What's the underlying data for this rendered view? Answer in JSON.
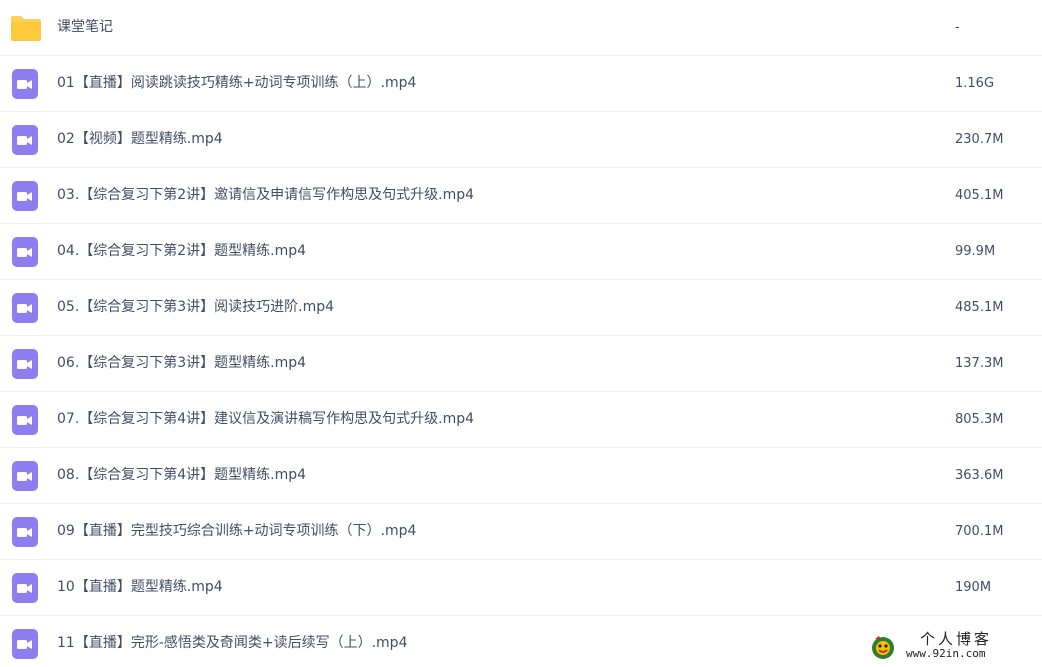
{
  "files": [
    {
      "name": "课堂笔记",
      "size": "-",
      "icon": "folder-icon",
      "color": "#ffd15c"
    },
    {
      "name": "01【直播】阅读跳读技巧精练+动词专项训练（上）.mp4",
      "size": "1.16G",
      "icon": "video-file-icon",
      "color": "#8c7df0"
    },
    {
      "name": "02【视频】题型精练.mp4",
      "size": "230.7M",
      "icon": "video-file-icon",
      "color": "#8c7df0"
    },
    {
      "name": "03.【综合复习下第2讲】邀请信及申请信写作构思及句式升级.mp4",
      "size": "405.1M",
      "icon": "video-file-icon",
      "color": "#8c7df0"
    },
    {
      "name": "04.【综合复习下第2讲】题型精练.mp4",
      "size": "99.9M",
      "icon": "video-file-icon",
      "color": "#8c7df0"
    },
    {
      "name": "05.【综合复习下第3讲】阅读技巧进阶.mp4",
      "size": "485.1M",
      "icon": "video-file-icon",
      "color": "#8c7df0"
    },
    {
      "name": "06.【综合复习下第3讲】题型精练.mp4",
      "size": "137.3M",
      "icon": "video-file-icon",
      "color": "#8c7df0"
    },
    {
      "name": "07.【综合复习下第4讲】建议信及演讲稿写作构思及句式升级.mp4",
      "size": "805.3M",
      "icon": "video-file-icon",
      "color": "#8c7df0"
    },
    {
      "name": "08.【综合复习下第4讲】题型精练.mp4",
      "size": "363.6M",
      "icon": "video-file-icon",
      "color": "#8c7df0"
    },
    {
      "name": "09【直播】完型技巧综合训练+动词专项训练（下）.mp4",
      "size": "700.1M",
      "icon": "video-file-icon",
      "color": "#8c7df0"
    },
    {
      "name": "10【直播】题型精练.mp4",
      "size": "190M",
      "icon": "video-file-icon",
      "color": "#8c7df0"
    },
    {
      "name": "11【直播】完形-感悟类及奇闻类+读后续写（上）.mp4",
      "size": "",
      "icon": "video-file-icon",
      "color": "#8c7df0"
    }
  ],
  "watermark": {
    "title": "个人博客",
    "url": "www.92in.com"
  }
}
